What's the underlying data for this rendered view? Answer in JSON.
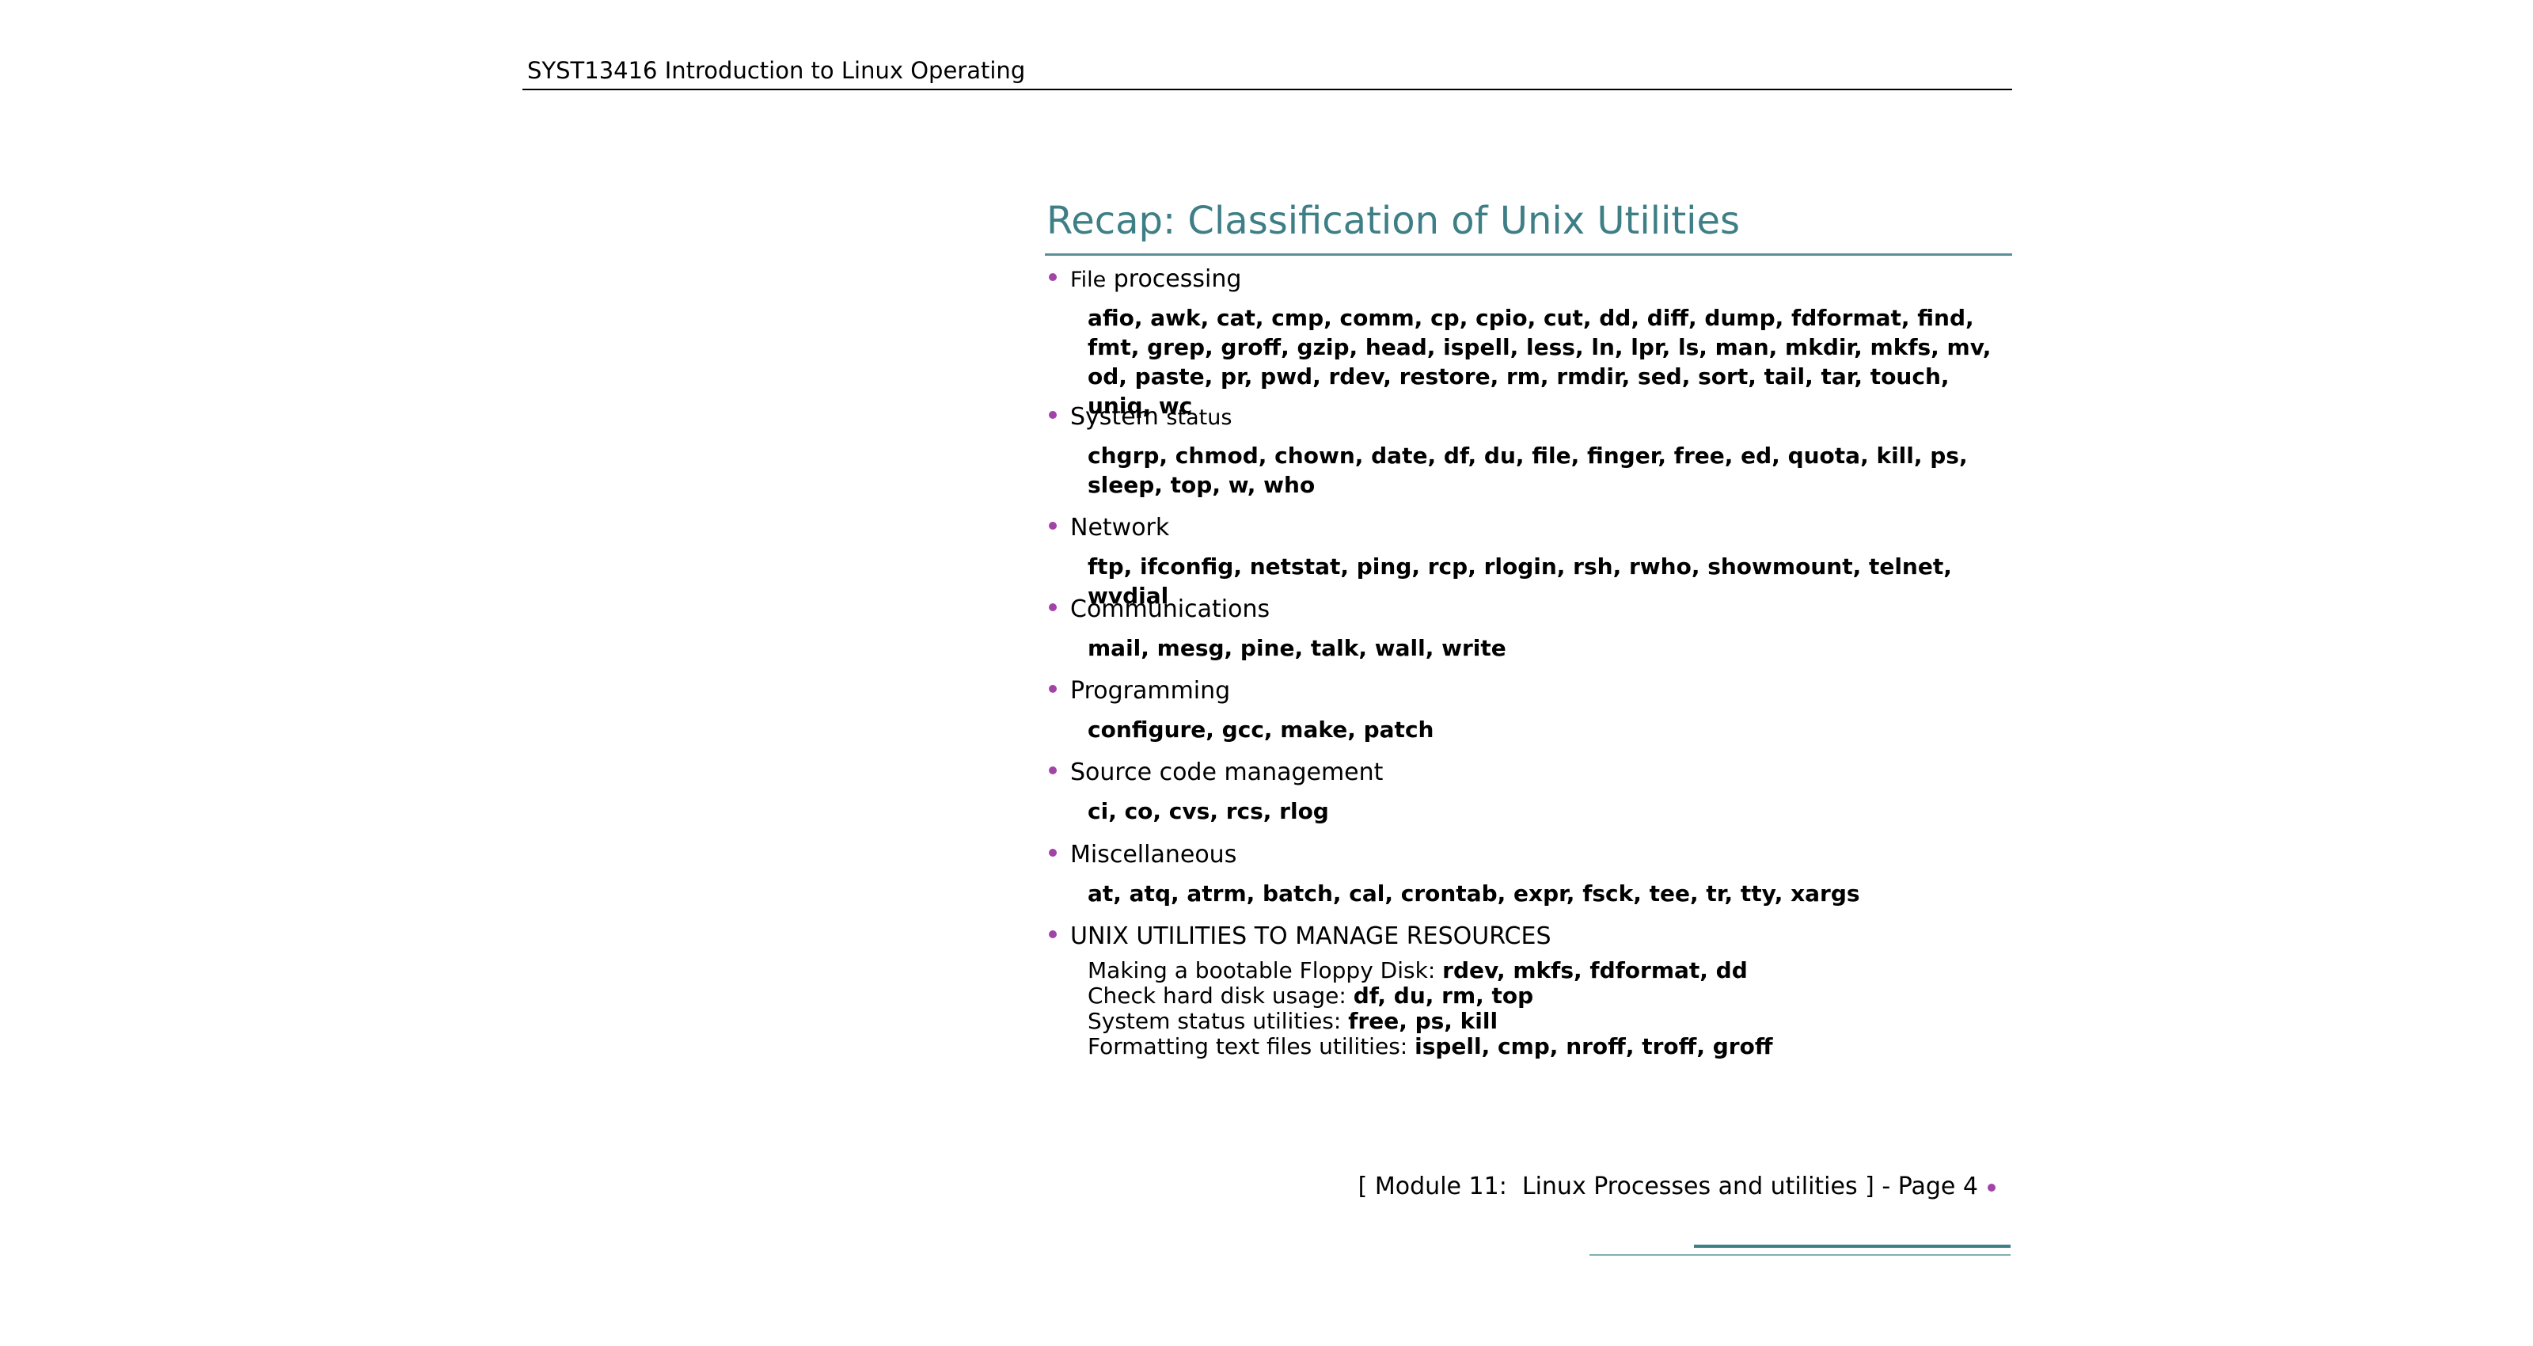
{
  "header": {
    "course": "SYST13416 Introduction to Linux Operating"
  },
  "slide": {
    "title": "Recap: Classification of Unix Utilities",
    "categories": [
      {
        "label_small": "File",
        "label_main": "processing",
        "commands": "afio, awk, cat, cmp, comm, cp, cpio, cut, dd, diff, dump, fdformat, find, fmt, grep, groff, gzip, head, ispell, less, ln, lpr, ls, man, mkdir, mkfs, mv, od, paste, pr, pwd, rdev, restore, rm, rmdir, sed, sort, tail, tar, touch, uniq, wc"
      },
      {
        "label_main": "System",
        "label_small": "status",
        "commands": "chgrp, chmod, chown, date, df, du, file, finger, free, ed, quota, kill, ps, sleep, top, w, who"
      },
      {
        "label_main": "Network",
        "commands": "ftp, ifconfig, netstat, ping, rcp, rlogin, rsh, rwho, showmount, telnet, wvdial"
      },
      {
        "label_main": "Communications",
        "commands": "mail, mesg, pine, talk, wall, write"
      },
      {
        "label_main": "Programming",
        "commands": "configure, gcc, make, patch"
      },
      {
        "label_main": "Source code management",
        "commands": "ci, co, cvs, rcs, rlog"
      },
      {
        "label_main": "Miscellaneous",
        "commands": "at, atq, atrm, batch, cal, crontab, expr, fsck, tee, tr, tty, xargs"
      },
      {
        "label_main": "UNIX UTILITIES TO MANAGE RESOURCES",
        "resources": [
          {
            "text": "Making a bootable Floppy Disk: ",
            "cmds": "rdev, mkfs, fdformat, dd"
          },
          {
            "text": "Check hard disk usage: ",
            "cmds": "df, du, rm, top"
          },
          {
            "text": "System status utilities: ",
            "cmds": "free, ps, kill"
          },
          {
            "text": "Formatting text files utilities: ",
            "cmds": "ispell, cmp, nroff, troff, groff"
          }
        ]
      }
    ]
  },
  "footer": {
    "text": "[ Module 11:  Linux Processes and utilities ] - Page 4"
  },
  "colors": {
    "title": "#3e7f86",
    "bullet": "#a243a8",
    "rule": "#5a8f97"
  }
}
